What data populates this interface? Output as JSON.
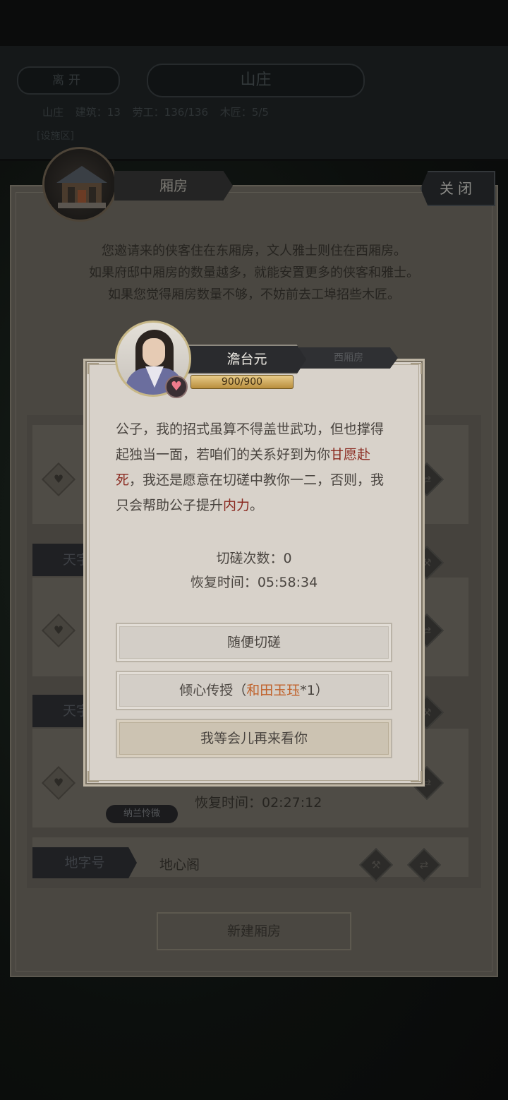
{
  "background": {
    "leave_button": "离开",
    "page_title": "山庄",
    "stats": [
      "建筑：13",
      "劳工：136/136",
      "木匠：5/5"
    ],
    "stats_left_label": "山庄",
    "subtab": "[设施区]",
    "room_title": "厢房",
    "close_button": "关闭",
    "description": [
      "您邀请来的侠客住在东厢房，文人雅士则住在西厢房。",
      "如果府邸中厢房的数量越多，就能安置更多的侠客和雅士。",
      "如果您觉得厢房数量不够，不妨前去工埠招些木匠。"
    ],
    "west_tab": "西厢房",
    "row_tab_1": "天字",
    "row_tab_2": "天字",
    "row_tab_3": "地字号",
    "row3_name": "地心阁",
    "resident_name": "纳兰怜微",
    "resident_recover_time": "恢复时间：02:27:12",
    "new_room_button": "新建厢房"
  },
  "dialog": {
    "character_name": "澹台元",
    "hp": "900/900",
    "speech": {
      "p1": "公子，我的招式虽算不得盖世武功，但也撑得起独当一面，若咱们的关系好到为你",
      "hl1": "甘愿赴死",
      "p2": "，我还是愿意在切磋中教你一二，否则，我只会帮助公子提升",
      "hl2": "内力",
      "p3": "。"
    },
    "spar_count": "切磋次数：0",
    "recover_time": "恢复时间：05:58:34",
    "btn_casual": "随便切磋",
    "btn_teach_prefix": "倾心传授（",
    "btn_teach_item": "和田玉珏",
    "btn_teach_suffix": "*1）",
    "btn_later": "我等会儿再来看你"
  }
}
